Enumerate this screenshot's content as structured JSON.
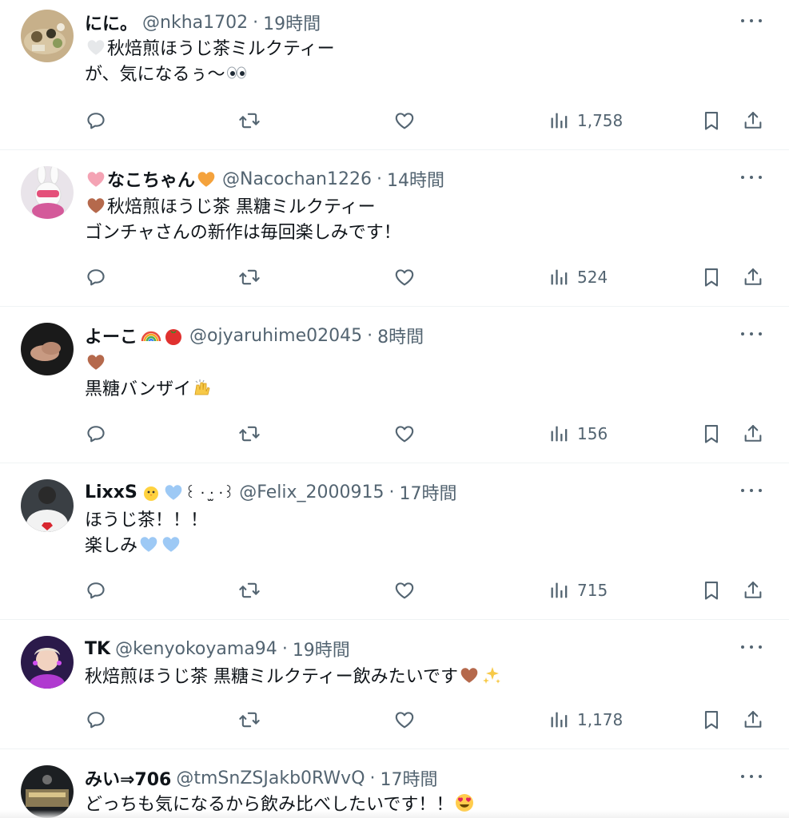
{
  "tweets": [
    {
      "name": "にに。",
      "handle": "@nkha1702",
      "sep": "·",
      "time": "19時間",
      "line1": "秋焙煎ほうじ茶ミルクティー",
      "line2": "が、気になるぅ〜",
      "views": "1,758"
    },
    {
      "name": "なこちゃん",
      "handle": "@Nacochan1226",
      "sep": "·",
      "time": "14時間",
      "line1": "秋焙煎ほうじ茶 黒糖ミルクティー",
      "line2": "ゴンチャさんの新作は毎回楽しみです！",
      "views": "524"
    },
    {
      "name": "よーこ",
      "handle": "@ojyaruhime02045",
      "sep": "·",
      "time": "8時間",
      "line1": "",
      "line2": "黒糖バンザイ",
      "views": "156"
    },
    {
      "name": "LixxS",
      "name_suffix": "꒰ · ·̫ ·꒱",
      "handle": "@Felix_2000915",
      "sep": "·",
      "time": "17時間",
      "line1": "ほうじ茶！！！",
      "line2": "楽しみ",
      "views": "715"
    },
    {
      "name": "TK",
      "handle": "@kenyokoyama94",
      "sep": "·",
      "time": "19時間",
      "line1": "秋焙煎ほうじ茶 黒糖ミルクティー飲みたいです",
      "views": "1,178"
    },
    {
      "name": "みい⇒706",
      "handle": "@tmSnZSJakb0RWvQ",
      "sep": "·",
      "time": "17時間",
      "line1": "どっちも気になるから飲み比べしたいです！！"
    }
  ],
  "colors": {
    "text_primary": "#0f1419",
    "text_secondary": "#536471",
    "divider": "#eff3f4",
    "heart_pink": "#f4a3b4",
    "heart_orange": "#f4a23c",
    "heart_brown": "#b5694c",
    "heart_blue": "#9dc9f5",
    "heart_white": "#e6e8ea"
  },
  "icons": [
    "more-icon",
    "reply-icon",
    "retweet-icon",
    "like-icon",
    "views-icon",
    "bookmark-icon",
    "share-icon"
  ]
}
